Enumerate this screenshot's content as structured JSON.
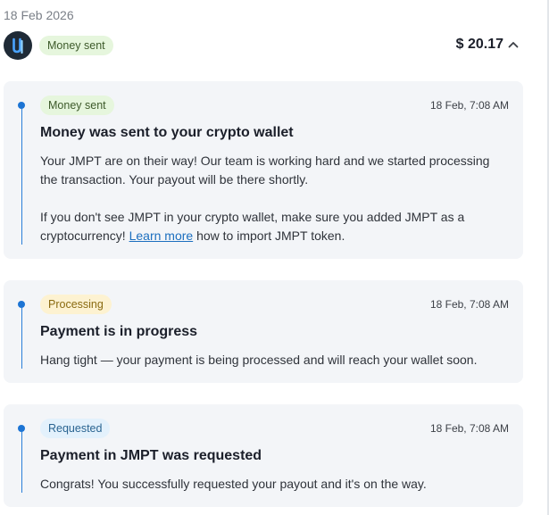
{
  "date_heading": "18 Feb 2026",
  "summary": {
    "status": "Money sent",
    "amount": "$ 20.17",
    "logo_icon": "app-logo-icon",
    "toggle_icon": "chevron-up-icon"
  },
  "events": [
    {
      "status": "Money sent",
      "time": "18 Feb, 7:08 AM",
      "title": "Money was sent to your crypto wallet",
      "p1_line1": "Your JMPT are on their way! Our team is working hard and we started processing",
      "p1_line2": "the transaction. Your payout will be there shortly.",
      "p2_line1": "If you don't see JMPT in your crypto wallet, make sure you added JMPT as a",
      "p2_line2_before": "cryptocurrency! ",
      "p2_link": "Learn more",
      "p2_line2_after": " how to import JMPT token."
    },
    {
      "status": "Processing",
      "time": "18 Feb, 7:08 AM",
      "title": "Payment is in progress",
      "body": "Hang tight — your payment is being processed and will reach your wallet soon."
    },
    {
      "status": "Requested",
      "time": "18 Feb, 7:08 AM",
      "title": "Payment in JMPT was requested",
      "body": "Congrats! You successfully requested your payout and it's on the way."
    }
  ],
  "colors": {
    "accent_blue": "#1c74d4",
    "badge_green": "#e6f6dd",
    "badge_yellow": "#fdf2d1",
    "badge_blue": "#e3f1fc",
    "card_bg": "#f3f5f8"
  }
}
